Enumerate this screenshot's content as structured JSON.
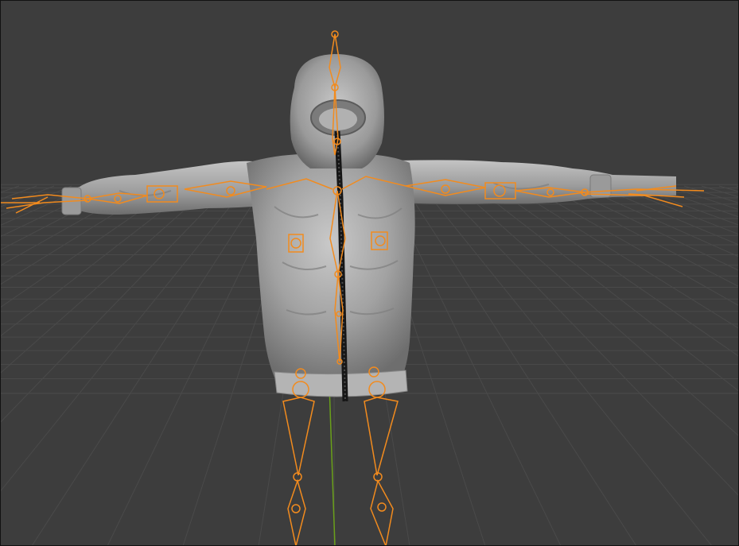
{
  "viewport": {
    "label": "",
    "background": "#3d3d3d",
    "grid_color": "#4a4a4a",
    "grid_axis_y_color": "#6aa01a"
  },
  "scene": {
    "mesh_name": "hoodie-mesh",
    "mesh_color": "#a9a9a9",
    "mesh_shadow": "#6b6b6b",
    "mesh_highlight": "#d7d7d7",
    "zipper_color": "#1a1a1a",
    "armature_color": "#f28b1e",
    "armature_selected": true
  }
}
